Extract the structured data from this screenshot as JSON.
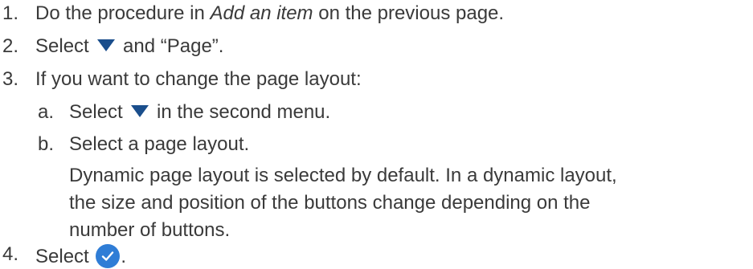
{
  "steps": [
    {
      "num": "1.",
      "before": "Do the procedure in ",
      "emph": "Add an item",
      "after": " on the previous page."
    },
    {
      "num": "2.",
      "before": "Select ",
      "after": " and “Page”."
    },
    {
      "num": "3.",
      "text": "If you want to change the page layout:",
      "substeps": [
        {
          "letter": "a.",
          "before": "Select ",
          "after": " in the second menu."
        },
        {
          "letter": "b.",
          "text": "Select a page layout.",
          "para_lines": [
            "Dynamic page layout is selected by default. In a dynamic layout,",
            "the size and position of the buttons change depending on the",
            "number of buttons."
          ]
        }
      ]
    },
    {
      "num": "4.",
      "before": "Select ",
      "after": "."
    }
  ],
  "icons": {
    "dropdown": "dropdown-triangle-icon",
    "confirm": "check-circle-icon"
  },
  "colors": {
    "text": "#3a3a3a",
    "accent": "#1a4e8c",
    "check_fill": "#2f7dd6"
  }
}
